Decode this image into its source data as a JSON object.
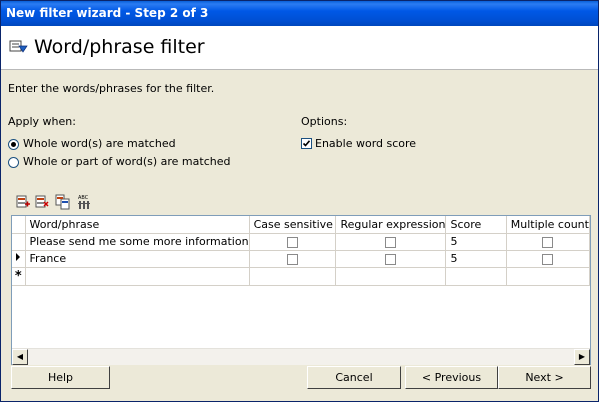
{
  "window": {
    "title": "New filter wizard - Step 2 of 3"
  },
  "header": {
    "title": "Word/phrase filter",
    "icon": "filter-wizard-icon"
  },
  "instructions": "Enter the words/phrases for the filter.",
  "apply_when": {
    "label": "Apply when:",
    "options": [
      "Whole word(s) are matched",
      "Whole or part of word(s) are matched"
    ],
    "selected": "Whole word(s) are matched"
  },
  "options": {
    "label": "Options:",
    "enable_word_score": {
      "label": "Enable word score",
      "checked": true
    }
  },
  "toolbar": {
    "icons": [
      "add-row-icon",
      "delete-row-icon",
      "copy-row-icon",
      "spellcheck-icon"
    ]
  },
  "grid": {
    "columns": [
      "Word/phrase",
      "Case sensitive",
      "Regular expression",
      "Score",
      "Multiple count"
    ],
    "rows": [
      {
        "word": "Please send me some more information",
        "case_sensitive": false,
        "regex": false,
        "score": "5",
        "multiple": false,
        "current": false
      },
      {
        "word": "France",
        "case_sensitive": false,
        "regex": false,
        "score": "5",
        "multiple": false,
        "current": true
      }
    ]
  },
  "buttons": {
    "help": "Help",
    "cancel": "Cancel",
    "previous": "< Previous",
    "next": "Next >"
  }
}
